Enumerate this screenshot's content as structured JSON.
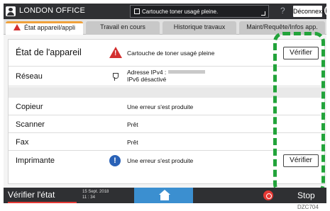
{
  "topbar": {
    "office": "LONDON OFFICE",
    "message": "Cartouche toner usagé pleine.",
    "help": "?",
    "logout": "Déconnexion"
  },
  "tabs": [
    {
      "label": "État appareil/appli"
    },
    {
      "label": "Travail en cours"
    },
    {
      "label": "Historique travaux"
    },
    {
      "label": "Maint/Requête/Infos app."
    }
  ],
  "rows": {
    "device": {
      "label": "État de l'appareil",
      "value": "Cartouche de toner usagé pleine",
      "button": "Vérifier"
    },
    "network": {
      "label": "Réseau",
      "value_line1": "Adresse IPv4 : ",
      "value_line2": "IPv6 désactivé"
    },
    "copier": {
      "label": "Copieur",
      "value": "Une erreur s'est produite"
    },
    "scanner": {
      "label": "Scanner",
      "value": "Prêt"
    },
    "fax": {
      "label": "Fax",
      "value": "Prêt"
    },
    "printer": {
      "label": "Imprimante",
      "value": "Une erreur s'est produite",
      "button": "Vérifier"
    }
  },
  "bottombar": {
    "check": "Vérifier l'état",
    "date_line1": "15 Sept. 2018",
    "date_line2": "11 : 34",
    "stop": "Stop"
  },
  "figure_code": "DZC704",
  "colors": {
    "highlight": "#22a33a",
    "warning": "#d32f2f",
    "info": "#2a62b7",
    "tab_accent": "#f0a13a",
    "home": "#3b8fd0"
  }
}
